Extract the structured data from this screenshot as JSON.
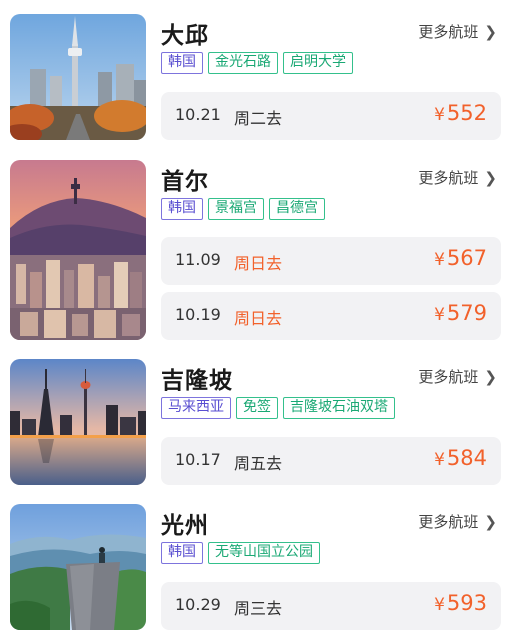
{
  "more_label": "更多航班",
  "colors": {
    "price": "#f2612b",
    "country_tag": "#5a4fd1",
    "spot_tag": "#1aa874",
    "flight_bg": "#f2f2f4"
  },
  "destinations": [
    {
      "city": "大邱",
      "photo": "daegu-tower-skyline",
      "tags": [
        "韩国",
        "金光石路",
        "启明大学"
      ],
      "flights": [
        {
          "date": "10.21",
          "weekday": "周二去",
          "currency": "¥",
          "price": "552"
        }
      ]
    },
    {
      "city": "首尔",
      "photo": "seoul-namsan-tower-city",
      "tags": [
        "韩国",
        "景福宫",
        "昌德宫"
      ],
      "flights": [
        {
          "date": "11.09",
          "weekday": "周日去",
          "currency": "¥",
          "price": "567"
        },
        {
          "date": "10.19",
          "weekday": "周日去",
          "currency": "¥",
          "price": "579"
        }
      ]
    },
    {
      "city": "吉隆坡",
      "photo": "kuala-lumpur-skyline-dusk",
      "tags": [
        "马来西亚",
        "免签",
        "吉隆坡石油双塔"
      ],
      "flights": [
        {
          "date": "10.17",
          "weekday": "周五去",
          "currency": "¥",
          "price": "584"
        }
      ]
    },
    {
      "city": "光州",
      "photo": "gwangju-mountain-cliff",
      "tags": [
        "韩国",
        "无等山国立公园"
      ],
      "flights": [
        {
          "date": "10.29",
          "weekday": "周三去",
          "currency": "¥",
          "price": "593"
        }
      ]
    }
  ]
}
